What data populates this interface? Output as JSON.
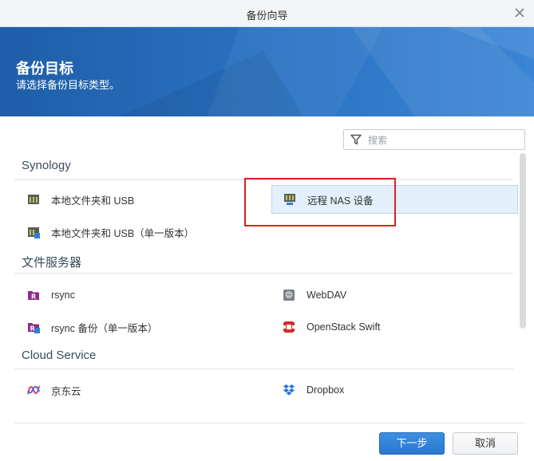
{
  "window": {
    "title": "备份向导"
  },
  "banner": {
    "heading": "备份目标",
    "subheading": "请选择备份目标类型。"
  },
  "search": {
    "placeholder": "搜索",
    "value": ""
  },
  "sections": [
    {
      "title": "Synology",
      "items": [
        {
          "label": "本地文件夹和 USB",
          "icon": "local-folder-icon"
        },
        {
          "label": "远程 NAS 设备",
          "icon": "remote-nas-icon",
          "selected": true
        },
        {
          "label": "本地文件夹和 USB（单一版本）",
          "icon": "local-folder-single-icon"
        }
      ]
    },
    {
      "title": "文件服务器",
      "items": [
        {
          "label": "rsync",
          "icon": "rsync-icon"
        },
        {
          "label": "WebDAV",
          "icon": "webdav-icon"
        },
        {
          "label": "rsync 备份（单一版本）",
          "icon": "rsync-single-icon"
        },
        {
          "label": "OpenStack Swift",
          "icon": "openstack-icon"
        }
      ]
    },
    {
      "title": "Cloud Service",
      "items": [
        {
          "label": "京东云",
          "icon": "jd-cloud-icon"
        },
        {
          "label": "Dropbox",
          "icon": "dropbox-icon"
        }
      ]
    }
  ],
  "footer": {
    "next_label": "下一步",
    "cancel_label": "取消"
  },
  "colors": {
    "accent": "#2a78cf",
    "selection": "#e3f0fb",
    "highlight": "#e02020"
  }
}
